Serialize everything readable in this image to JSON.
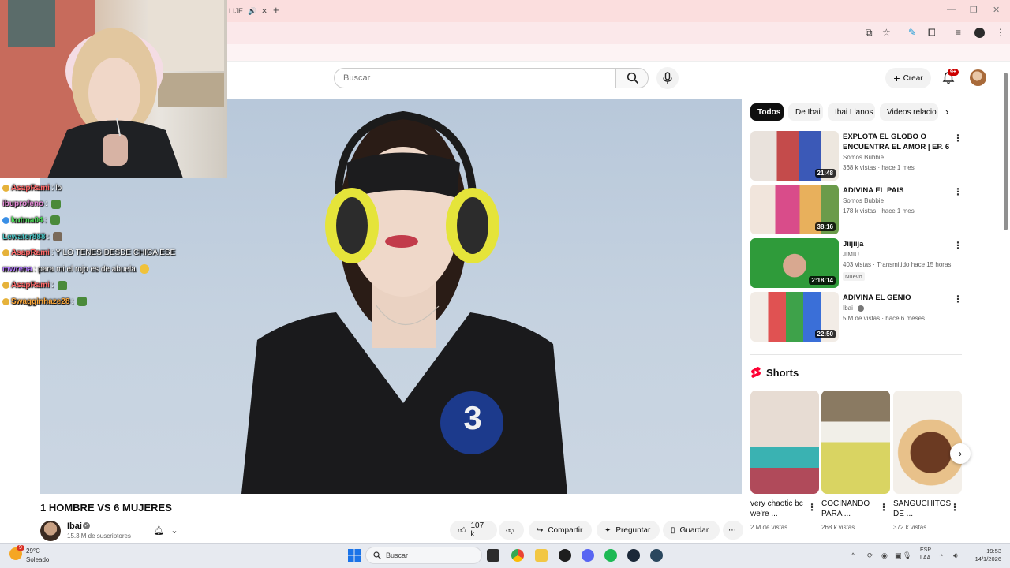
{
  "browser": {
    "tab_title": "LIJE",
    "new_tab_label": "+",
    "minimize": "—",
    "restore": "❐",
    "close": "✕"
  },
  "header": {
    "search_placeholder": "Buscar",
    "create_label": "Crear",
    "notifications_count": "9+"
  },
  "chat": [
    {
      "user": "AsapRami",
      "user_color": "#ff6b6b",
      "message": ": lo",
      "emote": false
    },
    {
      "user": "ibuprofeno",
      "user_color": "#e58ad6",
      "message": ":",
      "emote": true
    },
    {
      "user": "kutma04",
      "user_color": "#4ee05a",
      "message": ":",
      "emote": true
    },
    {
      "user": "Lewater888",
      "user_color": "#49c4c4",
      "message": ":",
      "emote": true
    },
    {
      "user": "AsapRami",
      "user_color": "#ff6b6b",
      "message": ": Y LO TENES DESDE CHICA ESE",
      "emote": false
    },
    {
      "user": "mwrena",
      "user_color": "#b67cff",
      "message": ": para mi el rojo es de abuela",
      "emote": true
    },
    {
      "user": "AsapRami",
      "user_color": "#ff6b6b",
      "message": ":",
      "emote": true
    },
    {
      "user": "Swagginhaze28",
      "user_color": "#ffaa3c",
      "message": ":",
      "emote": true
    }
  ],
  "video": {
    "title": "1 HOMBRE VS 6 MUJERES",
    "badge_number": "3",
    "channel_name": "Ibai",
    "subscribers": "15.3 M de suscriptores",
    "likes": "107 k",
    "share_label": "Compartir",
    "ask_label": "Preguntar",
    "save_label": "Guardar"
  },
  "chips": [
    "Todos",
    "De Ibai",
    "Ibai Llanos",
    "Videos relacio"
  ],
  "related": [
    {
      "title": "EXPLOTA EL GLOBO O ENCUENTRA EL AMOR | EP. 6",
      "channel": "Somos Bubbie",
      "meta": "368 k vistas · hace 1 mes",
      "duration": "21:48",
      "badge": ""
    },
    {
      "title": "ADIVINA EL PAIS",
      "channel": "Somos Bubbie",
      "meta": "178 k vistas · hace 1 mes",
      "duration": "38:16",
      "badge": ""
    },
    {
      "title": "Jiijiija",
      "channel": "JIMIU",
      "meta": "403 vistas · Transmitido hace 15 horas",
      "duration": "2:18:14",
      "badge": "Nuevo"
    },
    {
      "title": "ADIVINA EL GENIO",
      "channel": "Ibai",
      "meta": "5 M de vistas · hace 6 meses",
      "duration": "22:50",
      "badge": ""
    }
  ],
  "shorts": {
    "header": "Shorts",
    "items": [
      {
        "title": "very chaotic bc we're ...",
        "views": "2 M de vistas"
      },
      {
        "title": "COCINANDO PARA ...",
        "views": "268 k vistas"
      },
      {
        "title": "SANGUCHITOS DE ...",
        "views": "372 k vistas"
      }
    ]
  },
  "taskbar": {
    "weather_temp": "29°C",
    "weather_desc": "Soleado",
    "search_placeholder": "Buscar",
    "lang_line1": "ESP",
    "lang_line2": "LAA",
    "time": "19:53",
    "date": "14/1/2026",
    "weather_badge": "9"
  }
}
